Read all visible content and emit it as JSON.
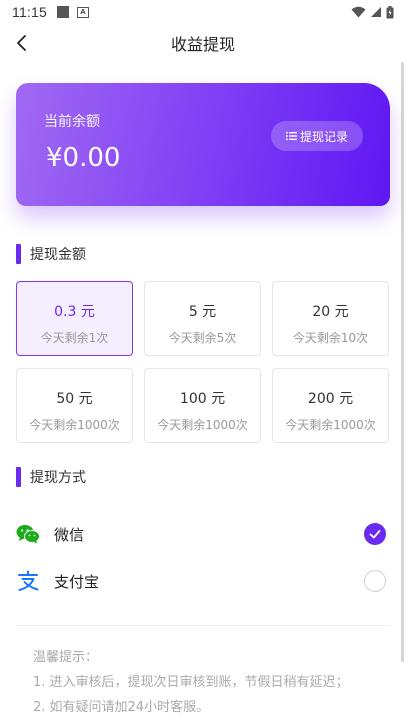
{
  "status_bar": {
    "time": "11:15",
    "a_icon_letter": "A"
  },
  "nav": {
    "title": "收益提现"
  },
  "balance_card": {
    "label": "当前余额",
    "amount": "¥0.00",
    "record_button": "提现记录"
  },
  "amount_section": {
    "title": "提现金额"
  },
  "amount_options": [
    {
      "value": "0.3 元",
      "remaining": "今天剩余1次",
      "selected": true
    },
    {
      "value": "5 元",
      "remaining": "今天剩余5次",
      "selected": false
    },
    {
      "value": "20 元",
      "remaining": "今天剩余10次",
      "selected": false
    },
    {
      "value": "50 元",
      "remaining": "今天剩余1000次",
      "selected": false
    },
    {
      "value": "100 元",
      "remaining": "今天剩余1000次",
      "selected": false
    },
    {
      "value": "200 元",
      "remaining": "今天剩余1000次",
      "selected": false
    }
  ],
  "method_section": {
    "title": "提现方式"
  },
  "methods": [
    {
      "name": "微信",
      "icon": "wechat-icon",
      "selected": true
    },
    {
      "name": "支付宝",
      "icon": "alipay-icon",
      "selected": false
    }
  ],
  "tips": {
    "title": "温馨提示：",
    "line1": "1. 进入审核后，提现次日审核到账，节假日稍有延迟；",
    "line2": "2. 如有疑问请加24小时客服。"
  },
  "colors": {
    "accent": "#6a2bf0",
    "wechat": "#1aad19",
    "alipay": "#1677ff"
  }
}
